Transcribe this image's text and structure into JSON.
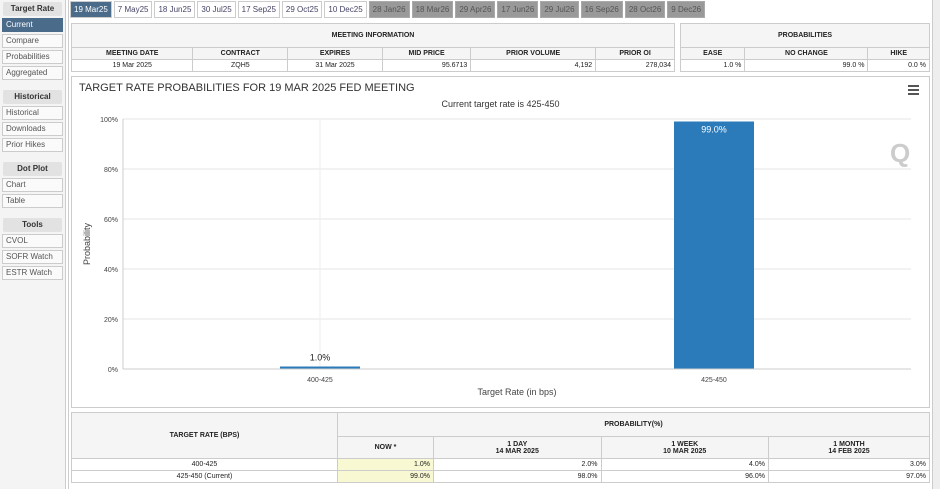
{
  "sidebar": {
    "sections": [
      {
        "title": "Target Rate",
        "items": [
          "Current",
          "Compare",
          "Probabilities",
          "Aggregated"
        ]
      },
      {
        "title": "Historical",
        "items": [
          "Historical",
          "Downloads",
          "Prior Hikes"
        ]
      },
      {
        "title": "Dot Plot",
        "items": [
          "Chart",
          "Table"
        ]
      },
      {
        "title": "Tools",
        "items": [
          "CVOL",
          "SOFR Watch",
          "ESTR Watch"
        ]
      }
    ]
  },
  "tabs": [
    "19 Mar25",
    "7 May25",
    "18 Jun25",
    "30 Jul25",
    "17 Sep25",
    "29 Oct25",
    "10 Dec25",
    "28 Jan26",
    "18 Mar26",
    "29 Apr26",
    "17 Jun26",
    "29 Jul26",
    "16 Sep26",
    "28 Oct26",
    "9 Dec26"
  ],
  "meeting": {
    "title": "MEETING INFORMATION",
    "headers": [
      "MEETING DATE",
      "CONTRACT",
      "EXPIRES",
      "MID PRICE",
      "PRIOR VOLUME",
      "PRIOR OI"
    ],
    "values": [
      "19 Mar 2025",
      "ZQH5",
      "31 Mar 2025",
      "95.6713",
      "4,192",
      "278,034"
    ]
  },
  "probabilities": {
    "title": "PROBABILITIES",
    "headers": [
      "EASE",
      "NO CHANGE",
      "HIKE"
    ],
    "values": [
      "1.0 %",
      "99.0 %",
      "0.0 %"
    ]
  },
  "chart_data": {
    "type": "bar",
    "title": "TARGET RATE PROBABILITIES FOR 19 MAR 2025 FED MEETING",
    "subtitle": "Current target rate is 425-450",
    "categories": [
      "400-425",
      "425-450"
    ],
    "values": [
      1.0,
      99.0
    ],
    "data_labels": [
      "1.0%",
      "99.0%"
    ],
    "xlabel": "Target Rate (in bps)",
    "ylabel": "Probability",
    "ylim": [
      0,
      100
    ],
    "yticks": [
      "0%",
      "20%",
      "40%",
      "60%",
      "80%",
      "100%"
    ],
    "color": "#2b7bba"
  },
  "table": {
    "col1": "TARGET RATE (BPS)",
    "group": "PROBABILITY(%)",
    "cols": [
      {
        "l1": "NOW *",
        "l2": ""
      },
      {
        "l1": "1 DAY",
        "l2": "14 MAR 2025"
      },
      {
        "l1": "1 WEEK",
        "l2": "10 MAR 2025"
      },
      {
        "l1": "1 MONTH",
        "l2": "14 FEB 2025"
      }
    ],
    "rows": [
      {
        "rate": "400-425",
        "vals": [
          "1.0%",
          "2.0%",
          "4.0%",
          "3.0%"
        ]
      },
      {
        "rate": "425-450 (Current)",
        "vals": [
          "99.0%",
          "98.0%",
          "96.0%",
          "97.0%"
        ]
      }
    ]
  }
}
